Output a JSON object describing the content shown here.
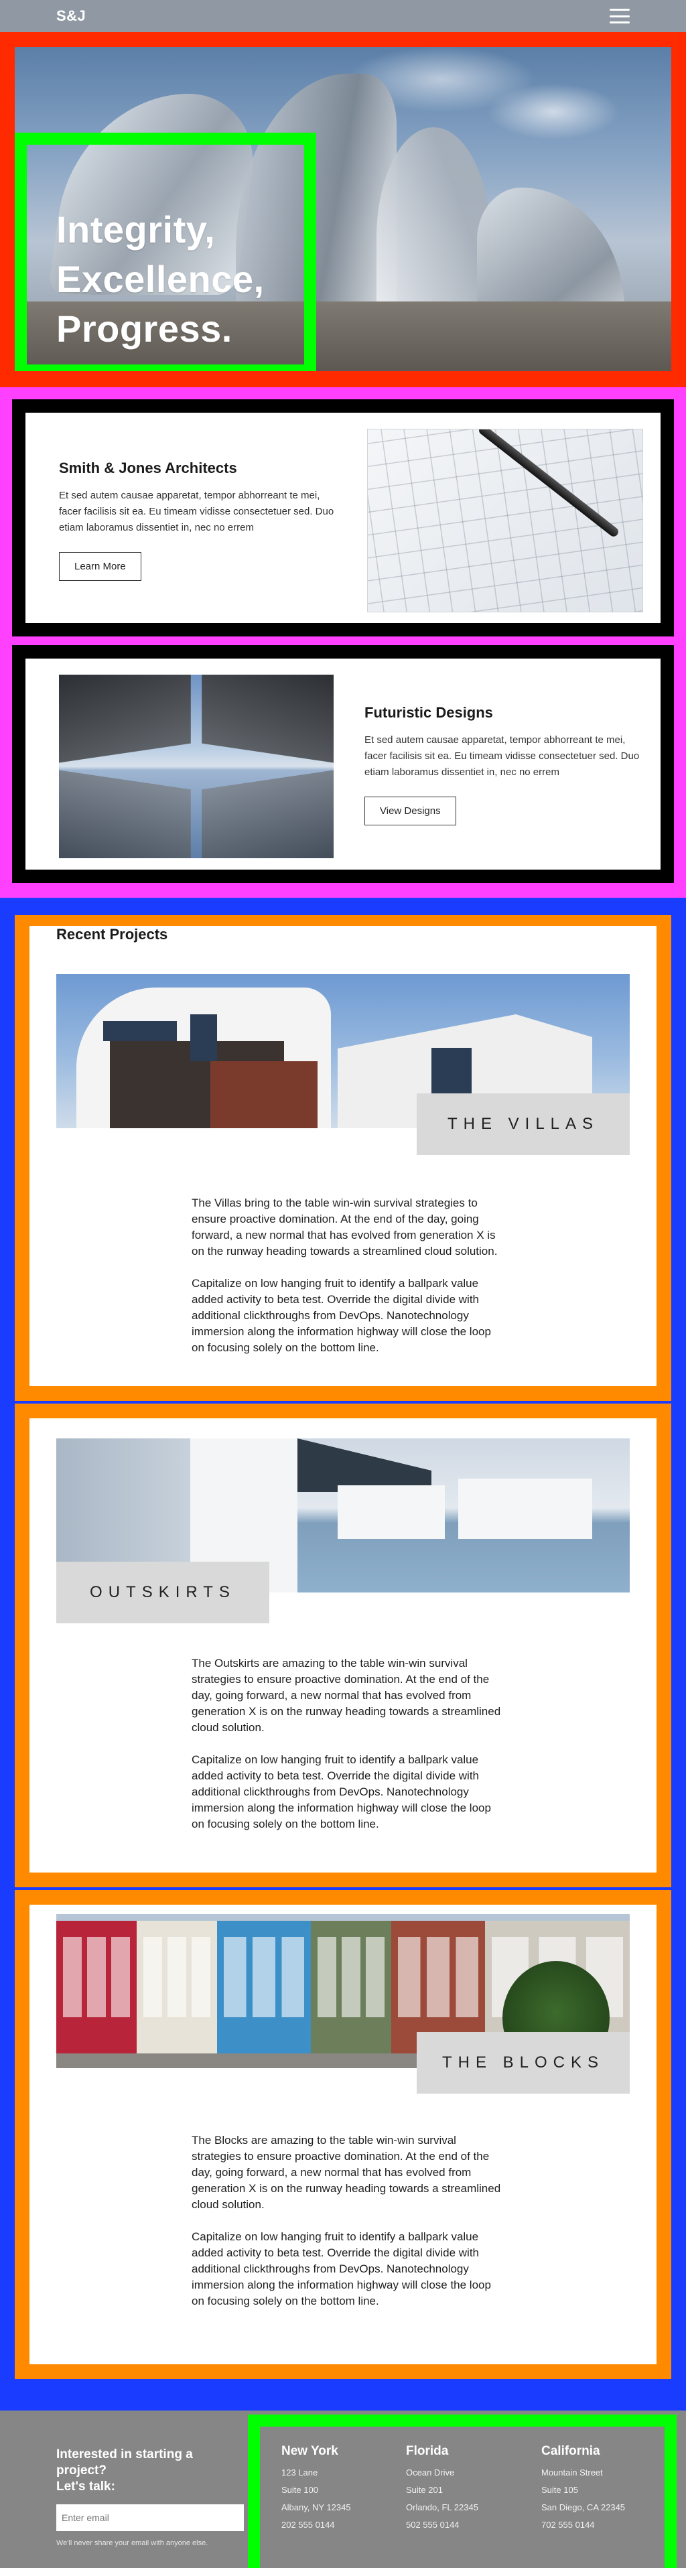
{
  "nav": {
    "brand": "S&J",
    "menu_icon": "hamburger-menu-icon"
  },
  "hero": {
    "title_line1": "Integrity,",
    "title_line2": "Excellence,",
    "title_line3": "Progress."
  },
  "services": [
    {
      "title": "Smith & Jones Architects",
      "body": "Et sed autem causae apparetat, tempor abhorreant te mei, facer facilisis sit ea. Eu timeam vidisse consectetuer sed. Duo etiam laboramus dissentiet in, nec no errem",
      "button": "Learn More"
    },
    {
      "title": "Futuristic Designs",
      "body": "Et sed autem causae apparetat, tempor abhorreant te mei, facer facilisis sit ea. Eu timeam vidisse consectetuer sed. Duo etiam laboramus dissentiet in, nec no errem",
      "button": "View Designs"
    }
  ],
  "projects": {
    "heading": "Recent Projects",
    "items": [
      {
        "label": "THE VILLAS",
        "p1": "The Villas bring to the table win-win survival strategies to ensure proactive domination. At the end of the day, going forward, a new normal that has evolved from generation X is on the runway heading towards a streamlined cloud solution.",
        "p2": "Capitalize on low hanging fruit to identify a ballpark value added activity to beta test. Override the digital divide with additional clickthroughs from DevOps. Nanotechnology immersion along the information highway will close the loop on focusing solely on the bottom line."
      },
      {
        "label": "OUTSKIRTS",
        "p1": "The Outskirts are amazing to the table win-win survival strategies to ensure proactive domination. At the end of the day, going forward, a new normal that has evolved from generation X is on the runway heading towards a streamlined cloud solution.",
        "p2": "Capitalize on low hanging fruit to identify a ballpark value added activity to beta test. Override the digital divide with additional clickthroughs from DevOps. Nanotechnology immersion along the information highway will close the loop on focusing solely on the bottom line."
      },
      {
        "label": "THE BLOCKS",
        "p1": "The Blocks are amazing to the table win-win survival strategies to ensure proactive domination. At the end of the day, going forward, a new normal that has evolved from generation X is on the runway heading towards a streamlined cloud solution.",
        "p2": "Capitalize on low hanging fruit to identify a ballpark value added activity to beta test. Override the digital divide with additional clickthroughs from DevOps. Nanotechnology immersion along the information highway will close the loop on focusing solely on the bottom line."
      }
    ]
  },
  "footer": {
    "cta_line1": "Interested in starting a project?",
    "cta_line2": "Let's talk:",
    "email_placeholder": "Enter email",
    "fineprint": "We'll never share your email with anyone else.",
    "offices": [
      {
        "name": "New York",
        "l1": "123 Lane",
        "l2": "Suite 100",
        "l3": "Albany, NY 12345",
        "phone": "202 555 0144"
      },
      {
        "name": "Florida",
        "l1": "Ocean Drive",
        "l2": "Suite 201",
        "l3": "Orlando, FL 22345",
        "phone": "502 555 0144"
      },
      {
        "name": "California",
        "l1": "Mountain Street",
        "l2": "Suite 105",
        "l3": "San Diego, CA 22345",
        "phone": "702 555 0144"
      }
    ]
  }
}
